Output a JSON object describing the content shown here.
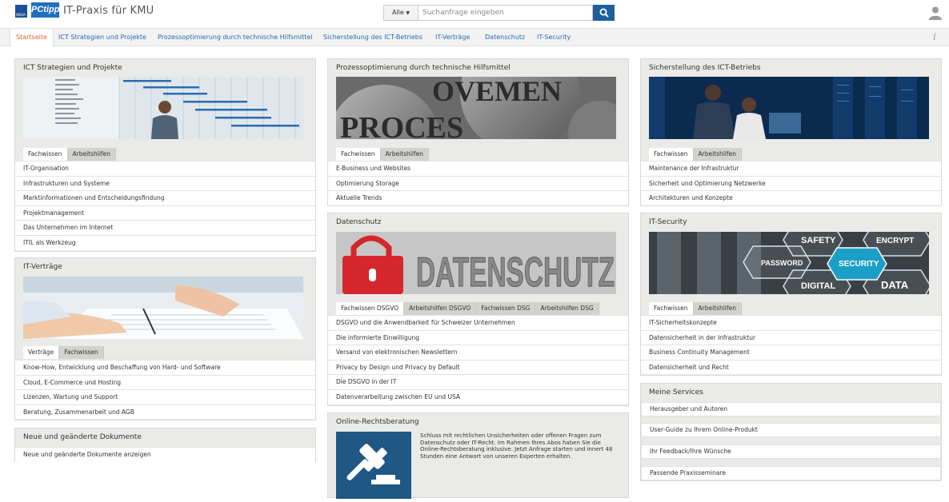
{
  "header": {
    "logo_weka": "WEKA",
    "logo_pctipp": "PCtipp",
    "title": "IT-Praxis für KMU",
    "search_scope": "Alle",
    "search_placeholder": "Suchanfrage eingeben",
    "search_icon": "search-icon",
    "user_icon": "user-icon"
  },
  "nav": {
    "tabs": [
      "Startseite",
      "ICT Strategien und Projekte",
      "Prozessoptimierung durch technische Hilfsmittel",
      "Sicherstellung des ICT-Betriebs",
      "IT-Verträge",
      "Datenschutz",
      "IT-Security"
    ],
    "active": "Startseite",
    "info_icon": "i"
  },
  "col1": {
    "ict": {
      "title": "ICT Strategien und Projekte",
      "tabs": [
        "Fachwissen",
        "Arbeitshilfen"
      ],
      "items": [
        "IT-Organisation",
        "Infrastrukturen und Systeme",
        "Marktinformationen und Entscheidungsfindung",
        "Projektmanagement",
        "Das Unternehmen im Internet",
        "ITIL als Werkzeug"
      ]
    },
    "vertraege": {
      "title": "IT-Verträge",
      "tabs": [
        "Verträge",
        "Fachwissen"
      ],
      "items": [
        "Know-How, Entwicklung und Beschaffung von Hard- und Software",
        "Cloud, E-Commerce und Hosting",
        "Lizenzen, Wartung und Support",
        "Beratung, Zusammenarbeit und AGB"
      ]
    },
    "neue": {
      "title": "Neue und geänderte Dokumente",
      "items": [
        "Neue und geänderte Dokumente anzeigen"
      ]
    }
  },
  "col2": {
    "prozess": {
      "title": "Prozessoptimierung durch technische Hilfsmittel",
      "image_text_1": "OVEMEN",
      "image_text_2": "PROCES",
      "tabs": [
        "Fachwissen",
        "Arbeitshilfen"
      ],
      "items": [
        "E-Business und Websites",
        "Optimierung Storage",
        "Aktuelle Trends"
      ]
    },
    "datenschutz": {
      "title": "Datenschutz",
      "image_text": "DATENSCHUTZ",
      "tabs": [
        "Fachwissen DSGVO",
        "Arbeitshilfen DSGVO",
        "Fachwissen DSG",
        "Arbeitshilfen DSG"
      ],
      "items": [
        "DSGVO und die Anwendbarkeit für Schweizer Unternehmen",
        "Die informierte Einwilligung",
        "Versand von elektronischen Newslettern",
        "Privacy by Design und Privacy by Default",
        "Die DSGVO in der IT",
        "Datenverarbeitung zwischen EU und USA"
      ]
    },
    "online": {
      "title": "Online-Rechtsberatung",
      "text": "Schluss mit rechtlichen Unsicherheiten oder offenen Fragen zum Datenschutz oder IT-Recht. Im Rahmen Ihres Abos haben Sie die Online-Rechtsberatung inklusive. Jetzt Anfrage starten und innert 48 Stunden eine Antwort von unseren Experten erhalten."
    }
  },
  "col3": {
    "betrieb": {
      "title": "Sicherstellung des ICT-Betriebs",
      "tabs": [
        "Fachwissen",
        "Arbeitshilfen"
      ],
      "items": [
        "Maintenance der Infrastruktur",
        "Sicherheit und Optimierung Netzwerke",
        "Architekturen und Konzepte"
      ]
    },
    "security": {
      "title": "IT-Security",
      "image_labels": [
        "SAFETY",
        "ENCRYPT",
        "PASSWORD",
        "SECURITY",
        "DIGITAL",
        "DATA"
      ],
      "tabs": [
        "Fachwissen",
        "Arbeitshilfen"
      ],
      "items": [
        "IT-Sicherheitskonzepte",
        "Datensicherheit in der Infrastruktur",
        "Business Continuity Management",
        "Datensicherheit und Recht"
      ]
    },
    "services": {
      "title": "Meine Services",
      "items": [
        "Herausgeber und Autoren",
        "User-Guide zu Ihrem Online-Produkt",
        "Ihr Feedback/Ihre Wünsche",
        "Passende Praxisseminare"
      ]
    }
  }
}
